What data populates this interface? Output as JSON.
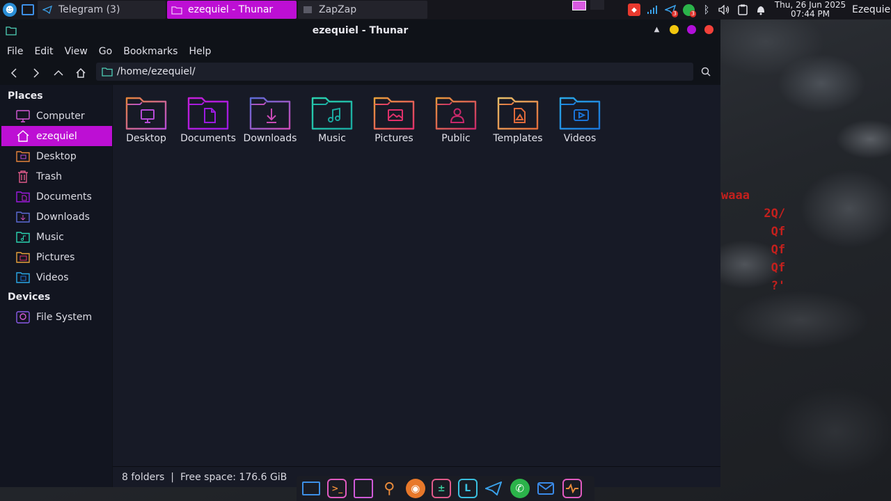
{
  "top_panel": {
    "tasks": [
      {
        "label": "Telegram (3)"
      },
      {
        "label": "ezequiel - Thunar"
      },
      {
        "label": "ZapZap"
      }
    ],
    "clock": {
      "date": "Thu, 26 Jun 2025",
      "time": "07:44 PM"
    },
    "user": "Ezequiel",
    "badges": {
      "telegram": "3",
      "whatsapp": "3"
    }
  },
  "window": {
    "title": "ezequiel - Thunar",
    "menu": [
      "File",
      "Edit",
      "View",
      "Go",
      "Bookmarks",
      "Help"
    ],
    "location": "/home/ezequiel/",
    "sidebar": {
      "places_header": "Places",
      "places": [
        {
          "label": "Computer",
          "icon": "computer-icon"
        },
        {
          "label": "ezequiel",
          "icon": "home-icon"
        },
        {
          "label": "Desktop",
          "icon": "desktop-folder-icon"
        },
        {
          "label": "Trash",
          "icon": "trash-icon"
        },
        {
          "label": "Documents",
          "icon": "documents-folder-icon"
        },
        {
          "label": "Downloads",
          "icon": "downloads-folder-icon"
        },
        {
          "label": "Music",
          "icon": "music-folder-icon"
        },
        {
          "label": "Pictures",
          "icon": "pictures-folder-icon"
        },
        {
          "label": "Videos",
          "icon": "videos-folder-icon"
        }
      ],
      "devices_header": "Devices",
      "devices": [
        {
          "label": "File System",
          "icon": "drive-icon"
        }
      ]
    },
    "folders": [
      {
        "label": "Desktop",
        "color1": "#e5843a",
        "color2": "#b64bd6",
        "glyph": "monitor"
      },
      {
        "label": "Documents",
        "color1": "#c41fd8",
        "color2": "#9b1ae0",
        "glyph": "document"
      },
      {
        "label": "Downloads",
        "color1": "#5c6bd6",
        "color2": "#c94ab5",
        "glyph": "download"
      },
      {
        "label": "Music",
        "color1": "#2ad3b0",
        "color2": "#1aa8a0",
        "glyph": "music"
      },
      {
        "label": "Pictures",
        "color1": "#e9a13a",
        "color2": "#e0306a",
        "glyph": "picture"
      },
      {
        "label": "Public",
        "color1": "#e99a3a",
        "color2": "#c8286a",
        "glyph": "person"
      },
      {
        "label": "Templates",
        "color1": "#e8c06a",
        "color2": "#e06a3a",
        "glyph": "template"
      },
      {
        "label": "Videos",
        "color1": "#2aa8e8",
        "color2": "#1a74d8",
        "glyph": "video"
      }
    ],
    "status": {
      "folders": "8 folders",
      "separator": "|",
      "free_space": "Free space: 176.6 GiB"
    }
  },
  "desktop": {
    "terminal_lines": [
      "waaa",
      "      2Q/",
      "       Qf",
      "       Qf",
      "       Qf",
      "       ?'"
    ]
  },
  "colors": {
    "accent": "#bd0fd4",
    "close": "#f2413a",
    "minimize": "#f3c70e",
    "maximize": "#b10fd9"
  }
}
